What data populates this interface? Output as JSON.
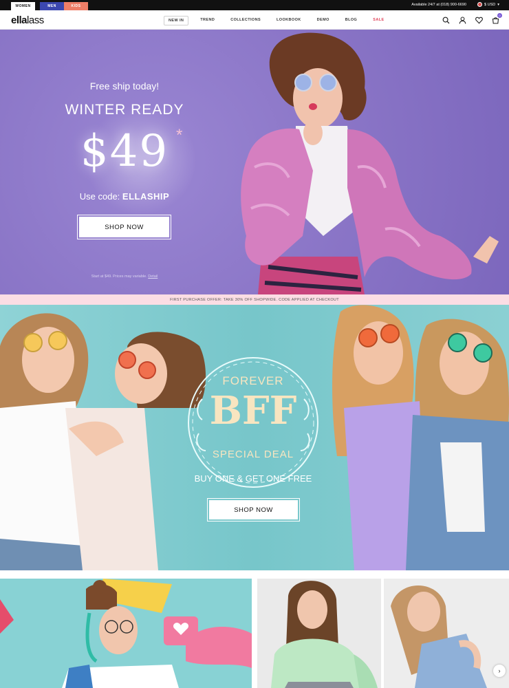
{
  "topbar": {
    "tabs": [
      {
        "label": "WOMEN",
        "color": "#ffffff"
      },
      {
        "label": "MEN",
        "color": "#3b47b0"
      },
      {
        "label": "KIDS",
        "color": "#ef7e67"
      }
    ],
    "availability": "Available 24/7 at (018) 900-6690",
    "currency": "$ USD"
  },
  "header": {
    "logo_bold": "ella",
    "logo_light": "lass",
    "nav": [
      "NEW IN",
      "TREND",
      "COLLECTIONS",
      "LOOKBOOK",
      "DEMO",
      "BLOG",
      "SALE"
    ],
    "icons": [
      "search-icon",
      "account-icon",
      "wishlist-icon",
      "cart-icon"
    ],
    "cart_count": "0"
  },
  "hero1": {
    "subtitle": "Free ship today!",
    "title": "WINTER READY",
    "price": "$49",
    "asterisk": "*",
    "code_prefix": "Use code: ",
    "code": "ELLASHIP",
    "button": "SHOP NOW",
    "fine_print": "Start at $49. Prices may variable.",
    "fine_link": "Detail",
    "bg_color": "#8c77c8"
  },
  "promo": {
    "text": "FIRST PURCHASE OFFER: TAKE 30% OFF SHOPWIDE. CODE APPLIED AT CHECKOUT"
  },
  "hero2": {
    "forever": "FOREVER",
    "bff": "BFF",
    "special": "SPECIAL DEAL",
    "buy": "BUY ONE & GET ONE FREE",
    "button": "SHOP NOW",
    "bg_color": "#7fc9cc"
  },
  "carousel": {
    "next_icon": "chevron-right-icon"
  }
}
